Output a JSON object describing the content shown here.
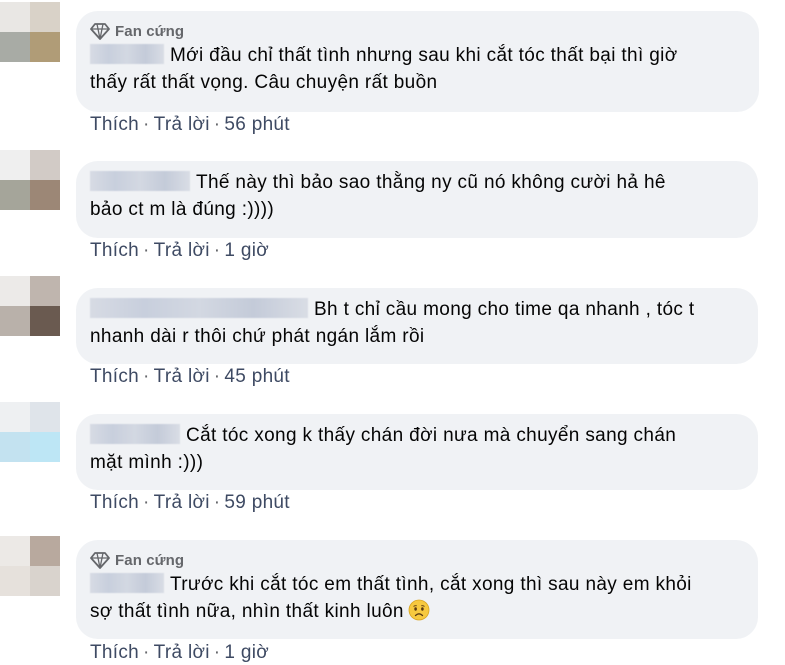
{
  "comments": [
    {
      "badge": "Fan cứng",
      "line1": "Mới đầu chỉ thất tình nhưng sau khi cắt tóc thất bại thì giờ",
      "line2": "thấy rất thất vọng. Câu chuyện rất buồn",
      "like": "Thích",
      "reply": "Trả lời",
      "time": "56 phút"
    },
    {
      "line1": "Thế này thì bảo sao thằng ny cũ nó không cười hả hê",
      "line2": "bảo ct m là đúng :))))",
      "like": "Thích",
      "reply": "Trả lời",
      "time": "1 giờ"
    },
    {
      "line1": "Bh t chỉ cầu mong cho time qa nhanh , tóc t",
      "line2": "nhanh dài r thôi chứ phát ngán lắm rồi",
      "like": "Thích",
      "reply": "Trả lời",
      "time": "45 phút"
    },
    {
      "line1": "Cắt tóc xong k thấy chán đời nưa mà chuyển sang chán",
      "line2": "mặt mình :)))",
      "like": "Thích",
      "reply": "Trả lời",
      "time": "59 phút"
    },
    {
      "badge": "Fan cứng",
      "line1": "Trước khi cắt tóc em thất tình, cắt xong thì sau này em khỏi",
      "line2": "sợ thất tình nữa, nhìn thất kinh luôn",
      "like": "Thích",
      "reply": "Trả lời",
      "time": "1 giờ"
    }
  ],
  "colors": {
    "bubble": "#f0f2f5",
    "action_text": "#3e4a63",
    "badge_text": "#65676b"
  },
  "icons": {
    "badge": "diamond-icon",
    "emoji": "worried-face-emoji"
  }
}
